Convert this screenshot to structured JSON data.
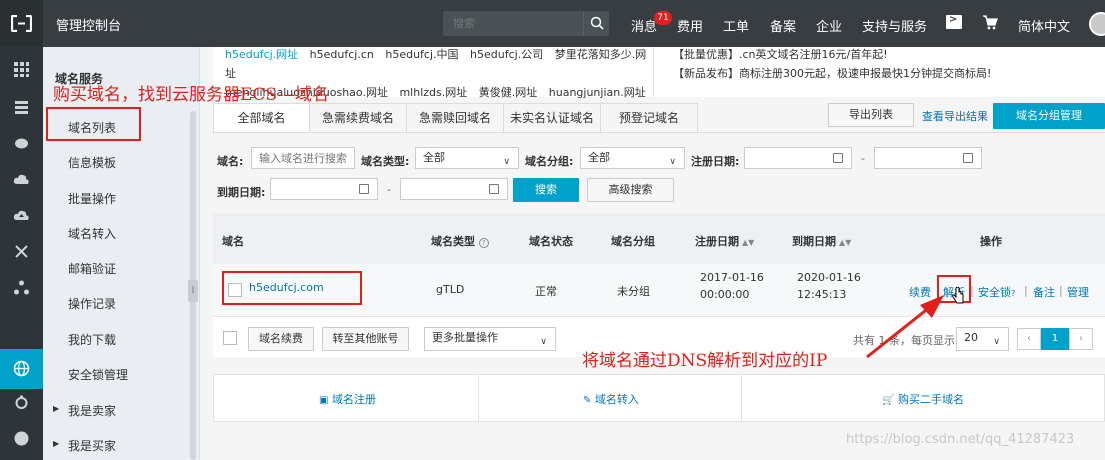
{
  "topbar": {
    "console_title": "管理控制台",
    "search_placeholder": "搜索",
    "messages_label": "消息",
    "messages_badge": "71",
    "fees_label": "费用",
    "tickets_label": "工单",
    "beian_label": "备案",
    "enterprise_label": "企业",
    "support_label": "支持与服务",
    "language_label": "简体中文"
  },
  "sidebar": {
    "title": "域名服务",
    "items": [
      {
        "label": "域名列表"
      },
      {
        "label": "信息模板"
      },
      {
        "label": "批量操作"
      },
      {
        "label": "域名转入"
      },
      {
        "label": "邮箱验证"
      },
      {
        "label": "操作记录"
      },
      {
        "label": "我的下载"
      },
      {
        "label": "安全锁管理"
      },
      {
        "label": "我是卖家"
      },
      {
        "label": "我是买家"
      }
    ]
  },
  "banner": {
    "left_line1": [
      "h5edufcj.网址",
      "h5edufcj.cn",
      "h5edufcj.中国",
      "h5edufcj.公司",
      "梦里花落知多少.网址"
    ],
    "left_line2": [
      "menglihualuozhiduoshao.网址",
      "mlhlzds.网址",
      "黄俊健.网址",
      "huangjunjian.网址"
    ],
    "right_line1": "【批量优惠】.cn英文域名注册16元/首年起!",
    "right_line2": "【新品发布】商标注册300元起，极速申报最快1分钟提交商标局!"
  },
  "tabs": [
    "全部域名",
    "急需续费域名",
    "急需赎回域名",
    "未实名认证域名",
    "预登记域名"
  ],
  "toolbar": {
    "export_list": "导出列表",
    "view_export_result": "查看导出结果",
    "group_manage": "域名分组管理"
  },
  "filters": {
    "domain_label": "域名:",
    "domain_placeholder": "输入域名进行搜索",
    "type_label": "域名类型:",
    "type_value": "全部",
    "group_label": "域名分组:",
    "group_value": "全部",
    "reg_date_label": "注册日期:",
    "expire_date_label": "到期日期:",
    "search_button": "搜索",
    "advanced_search": "高级搜索",
    "dash": "-"
  },
  "table": {
    "headers": {
      "domain": "域名",
      "type": "域名类型",
      "status": "域名状态",
      "group": "域名分组",
      "reg_date": "注册日期",
      "expire_date": "到期日期",
      "actions": "操作"
    },
    "rows": [
      {
        "domain": "h5edufcj.com",
        "type": "gTLD",
        "status": "正常",
        "group": "未分组",
        "reg_date": "2017-01-16",
        "reg_time": "00:00:00",
        "expire_date": "2020-01-16",
        "expire_time": "12:45:13",
        "actions": {
          "renew": "续费",
          "resolve": "解析",
          "lock": "安全锁",
          "note": "备注",
          "manage": "管理"
        }
      }
    ]
  },
  "footer": {
    "renew_button": "域名续费",
    "transfer_button": "转至其他账号",
    "more_actions": "更多批量操作",
    "total_text": "共有 1 条，每页显示:",
    "page_size": "20",
    "prev": "‹",
    "current_page": "1",
    "next": "›"
  },
  "shortcuts": {
    "register": "域名注册",
    "transfer_in": "域名转入",
    "buy_second_hand": "购买二手域名"
  },
  "annotations": {
    "top_note": "购买域名，找到云服务器ECS---域名",
    "bottom_note": "将域名通过DNS解析到对应的IP"
  },
  "watermark": "https://blog.csdn.net/qq_41287423",
  "colors": {
    "accent": "#00a2ca",
    "topbar": "#373d41",
    "annotation_red": "#e0201a",
    "link": "#0077bb"
  }
}
